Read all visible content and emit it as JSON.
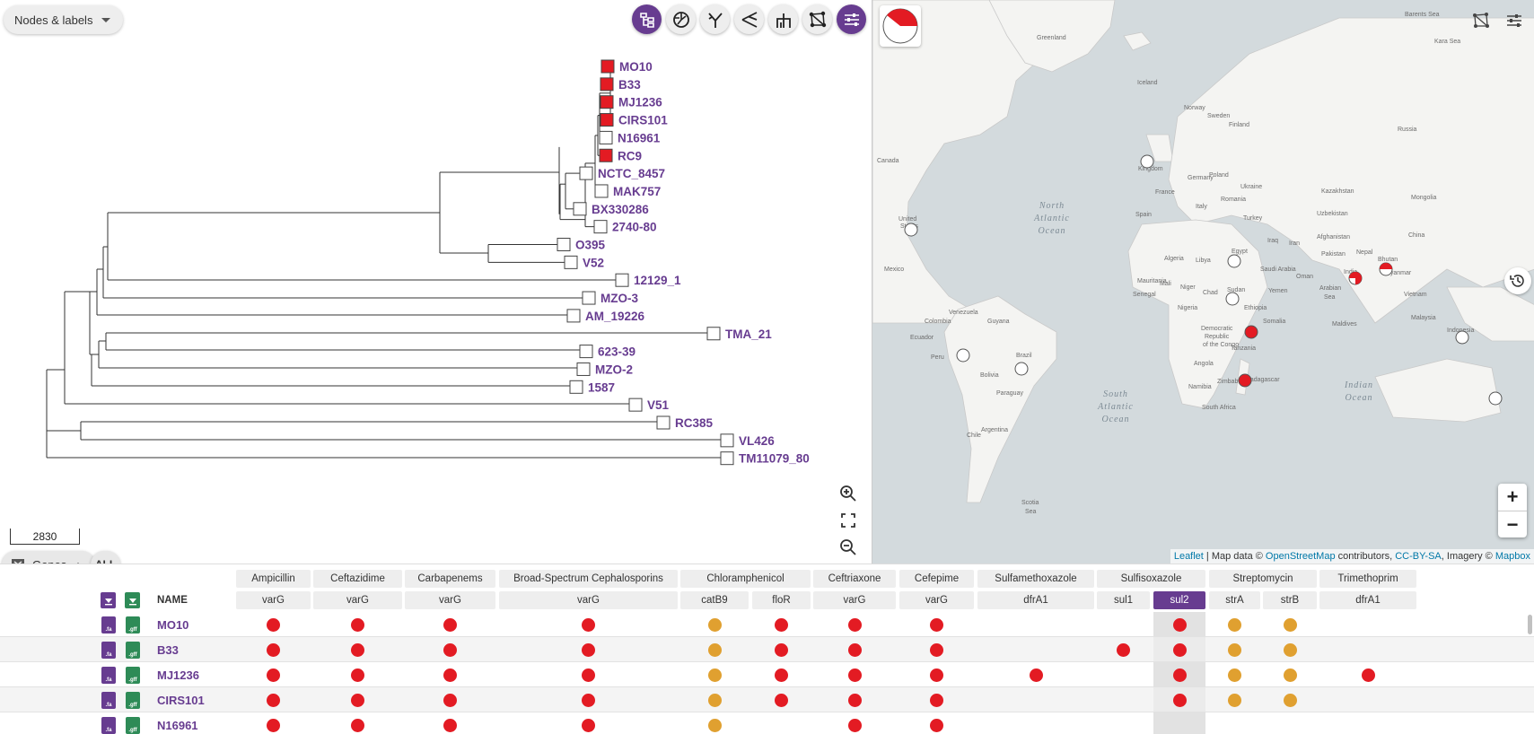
{
  "tree": {
    "dropdown_label": "Nodes & labels",
    "scale_value": "2830",
    "leaves": [
      {
        "name": "MO10",
        "filled": true
      },
      {
        "name": "B33",
        "filled": true
      },
      {
        "name": "MJ1236",
        "filled": true
      },
      {
        "name": "CIRS101",
        "filled": true
      },
      {
        "name": "N16961",
        "filled": false
      },
      {
        "name": "RC9",
        "filled": true
      },
      {
        "name": "NCTC_8457",
        "filled": false
      },
      {
        "name": "MAK757",
        "filled": false
      },
      {
        "name": "BX330286",
        "filled": false
      },
      {
        "name": "2740-80",
        "filled": false
      },
      {
        "name": "O395",
        "filled": false
      },
      {
        "name": "V52",
        "filled": false
      },
      {
        "name": "12129_1",
        "filled": false
      },
      {
        "name": "MZO-3",
        "filled": false
      },
      {
        "name": "AM_19226",
        "filled": false
      },
      {
        "name": "TMA_21",
        "filled": false
      },
      {
        "name": "623-39",
        "filled": false
      },
      {
        "name": "MZO-2",
        "filled": false
      },
      {
        "name": "1587",
        "filled": false
      },
      {
        "name": "V51",
        "filled": false
      },
      {
        "name": "RC385",
        "filled": false
      },
      {
        "name": "VL426",
        "filled": false
      },
      {
        "name": "TM11079_80",
        "filled": false
      }
    ],
    "tools": [
      "rectangular-tree-icon",
      "circular-tree-icon",
      "radial-tree-icon",
      "diagonal-tree-icon",
      "hierarchical-tree-icon",
      "network-icon",
      "sliders-icon"
    ]
  },
  "map": {
    "ocean_labels": {
      "north_atlantic": [
        "North",
        "Atlantic",
        "Ocean"
      ],
      "south_atlantic": [
        "South",
        "Atlantic",
        "Ocean"
      ],
      "indian": [
        "Indian",
        "Ocean"
      ],
      "arabian_sea": [
        "Arabian",
        "Sea"
      ],
      "scotia_sea": [
        "Scotia",
        "Sea"
      ]
    },
    "place_labels": {
      "greenland": "Greenland",
      "canada": "Canada",
      "united_states": "United States",
      "mexico": "Mexico",
      "venezuela": "Venezuela",
      "colombia": "Colombia",
      "ecuador": "Ecuador",
      "peru": "Peru",
      "brazil": "Brazil",
      "bolivia": "Bolivia",
      "paraguay": "Paraguay",
      "chile": "Chile",
      "argentina": "Argentina",
      "iceland": "Iceland",
      "norway": "Norway",
      "sweden": "Sweden",
      "finland": "Finland",
      "kingdom": "Kingdom",
      "germany": "Germany",
      "poland": "Poland",
      "france": "France",
      "spain": "Spain",
      "ukraine": "Ukraine",
      "romania": "Romania",
      "italy": "Italy",
      "turkey": "Turkey",
      "russia": "Russia",
      "kazakhstan": "Kazakhstan",
      "uzbekistan": "Uzbekistan",
      "mongolia": "Mongolia",
      "china": "China",
      "iran": "Iran",
      "iraq": "Iraq",
      "afghanistan": "Afghanistan",
      "pakistan": "Pakistan",
      "nepal": "Nepal",
      "india": "India",
      "bhutan": "Bhutan",
      "saudi_arabia": "Saudi Arabia",
      "yemen": "Yemen",
      "oman": "Oman",
      "egypt": "Egypt",
      "libya": "Libya",
      "algeria": "Algeria",
      "mauritania": "Mauritania",
      "mali": "Mali",
      "niger": "Niger",
      "chad": "Chad",
      "sudan": "Sudan",
      "ethiopia": "Ethiopia",
      "somalia": "Somalia",
      "nigeria": "Nigeria",
      "senegal": "Senegal",
      "democratic": "Democratic",
      "republic": "Republic",
      "of_the_congo": "of the Congo",
      "tanzania": "Tanzania",
      "angola": "Angola",
      "zimbabwe": "Zimbabwe",
      "namibia": "Namibia",
      "south_africa": "South Africa",
      "madagascar": "Madagascar",
      "myanmar": "Myanmar",
      "vietnam": "Vietnam",
      "malaysia": "Malaysia",
      "indonesia": "Indonesia",
      "maldives": "Maldives",
      "barents_sea": "Barents Sea",
      "kara_sea": "Kara Sea",
      "united": "United",
      "states": "States",
      "guyana": "Guyana"
    },
    "attribution": {
      "leaflet": "Leaflet",
      "sep": " | Map data © ",
      "osm": "OpenStreetMap",
      "contrib": " contributors, ",
      "license": "CC-BY-SA",
      "imagery": ", Imagery © ",
      "mapbox": "Mapbox"
    },
    "zoom_in": "+",
    "zoom_out": "−"
  },
  "genes": {
    "button_label": "Genes",
    "all_label": "ALL",
    "name_header": "NAME",
    "groups": [
      "Ampicillin",
      "Ceftazidime",
      "Carbapenems",
      "Broad-Spectrum Cephalosporins",
      "Chloramphenicol",
      "Ceftriaxone",
      "Cefepime",
      "Sulfamethoxazole",
      "Sulfisoxazole",
      "Streptomycin",
      "Trimethoprim"
    ],
    "genes": [
      "varG",
      "varG",
      "varG",
      "varG",
      "catB9",
      "floR",
      "varG",
      "varG",
      "dfrA1",
      "sul1",
      "sul2",
      "strA",
      "strB",
      "dfrA1"
    ],
    "selected_gene": "sul2",
    "file_labels": {
      "fa": ".fa",
      "gff": ".gff"
    },
    "rows": [
      {
        "name": "MO10",
        "cells": [
          "r",
          "r",
          "r",
          "r",
          "o",
          "r",
          "r",
          "r",
          "",
          "",
          "r",
          "o",
          "o",
          ""
        ]
      },
      {
        "name": "B33",
        "cells": [
          "r",
          "r",
          "r",
          "r",
          "o",
          "r",
          "r",
          "r",
          "",
          "r",
          "r",
          "o",
          "o",
          ""
        ]
      },
      {
        "name": "MJ1236",
        "cells": [
          "r",
          "r",
          "r",
          "r",
          "o",
          "r",
          "r",
          "r",
          "r",
          "",
          "r",
          "o",
          "o",
          "r"
        ]
      },
      {
        "name": "CIRS101",
        "cells": [
          "r",
          "r",
          "r",
          "r",
          "o",
          "r",
          "r",
          "r",
          "",
          "",
          "r",
          "o",
          "o",
          ""
        ]
      },
      {
        "name": "N16961",
        "cells": [
          "r",
          "r",
          "r",
          "r",
          "o",
          "",
          "r",
          "r",
          "",
          "",
          "",
          "",
          "",
          ""
        ]
      }
    ]
  }
}
